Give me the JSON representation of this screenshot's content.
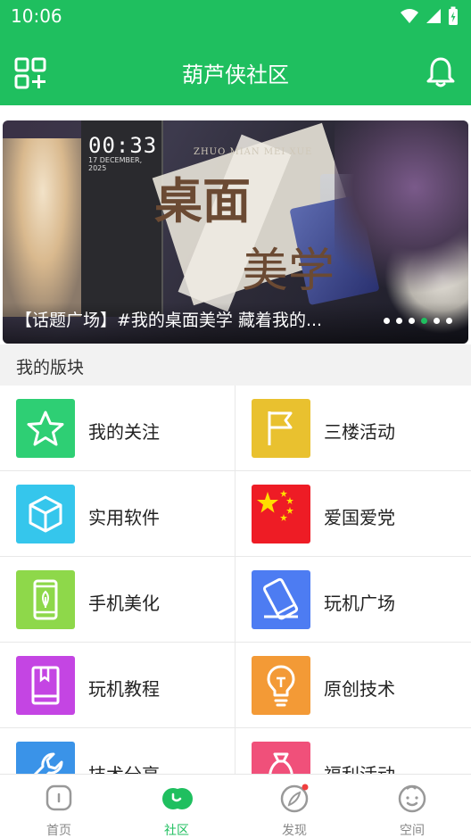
{
  "status_bar": {
    "time": "10:06"
  },
  "app_bar": {
    "title": "葫芦侠社区"
  },
  "banner": {
    "caption": "【话题广场】#我的桌面美学 藏着我的...",
    "artwork_text_1": "桌面",
    "artwork_text_2": "美学",
    "artwork_phone_time": "00:33",
    "artwork_phone_date": "17 DECEMBER, 2025",
    "artwork_english": "ZHUO MIAN MEI XUE",
    "dots_count": 6,
    "active_dot": 3
  },
  "section": {
    "title": "我的版块"
  },
  "categories": [
    {
      "label": "我的关注",
      "icon": "star-icon",
      "color": "#2ecf74"
    },
    {
      "label": "三楼活动",
      "icon": "flag-icon",
      "color": "#e9c12f"
    },
    {
      "label": "实用软件",
      "icon": "cube-icon",
      "color": "#35c6ec"
    },
    {
      "label": "爱国爱党",
      "icon": "china-flag-icon",
      "color": "#ee1c25"
    },
    {
      "label": "手机美化",
      "icon": "phone-leaf-icon",
      "color": "#8ed84a"
    },
    {
      "label": "玩机广场",
      "icon": "phone-tilt-icon",
      "color": "#4d7cf2"
    },
    {
      "label": "玩机教程",
      "icon": "book-icon",
      "color": "#c445e3"
    },
    {
      "label": "原创技术",
      "icon": "bulb-icon",
      "color": "#f39a36"
    },
    {
      "label": "技术分享",
      "icon": "wrench-icon",
      "color": "#3a93e8"
    },
    {
      "label": "福利活动",
      "icon": "money-bag-icon",
      "color": "#f0507a"
    }
  ],
  "bottom_nav": [
    {
      "label": "首页",
      "icon": "home-icon",
      "active": false
    },
    {
      "label": "社区",
      "icon": "community-icon",
      "active": true
    },
    {
      "label": "发现",
      "icon": "compass-icon",
      "active": false,
      "badge": true
    },
    {
      "label": "空间",
      "icon": "face-icon",
      "active": false
    }
  ],
  "colors": {
    "primary": "#1fbf5f",
    "section_bg": "#f2f2f2"
  }
}
